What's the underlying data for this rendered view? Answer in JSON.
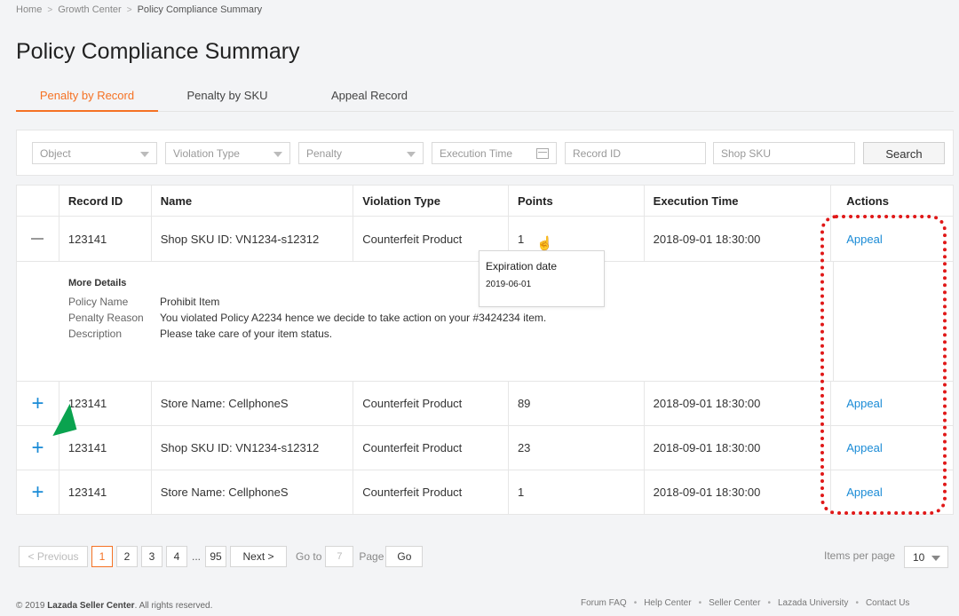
{
  "breadcrumb": [
    "Home",
    "Growth Center",
    "Policy Compliance Summary"
  ],
  "page_title": "Policy Compliance Summary",
  "tabs": [
    {
      "label": "Penalty by Record",
      "active": true
    },
    {
      "label": "Penalty by SKU",
      "active": false
    },
    {
      "label": "Appeal Record",
      "active": false
    }
  ],
  "filters": {
    "object": "Object",
    "violation_type": "Violation Type",
    "penalty": "Penalty",
    "execution_time": "Execution Time",
    "record_id": "Record ID",
    "shop_sku": "Shop SKU",
    "search_label": "Search"
  },
  "table": {
    "headers": [
      "Record ID",
      "Name",
      "Violation Type",
      "Points",
      "Execution Time",
      "Actions"
    ],
    "rows": [
      {
        "record_id": "123141",
        "name": "Shop SKU ID: VN1234-s12312",
        "violation": "Counterfeit Product",
        "points": "1",
        "time": "2018-09-01 18:30:00",
        "action": "Appeal",
        "expanded": true
      },
      {
        "record_id": "123141",
        "name": "Store Name: CellphoneS",
        "violation": "Counterfeit Product",
        "points": "89",
        "time": "2018-09-01 18:30:00",
        "action": "Appeal",
        "expanded": false
      },
      {
        "record_id": "123141",
        "name": "Shop SKU ID: VN1234-s12312",
        "violation": "Counterfeit Product",
        "points": "23",
        "time": "2018-09-01 18:30:00",
        "action": "Appeal",
        "expanded": false
      },
      {
        "record_id": "123141",
        "name": "Store Name: CellphoneS",
        "violation": "Counterfeit Product",
        "points": "1",
        "time": "2018-09-01 18:30:00",
        "action": "Appeal",
        "expanded": false
      }
    ]
  },
  "details": {
    "title": "More Details",
    "policy_name_label": "Policy Name",
    "policy_name": "Prohibit Item",
    "penalty_reason_label": "Penalty Reason",
    "penalty_reason": "You violated Policy A2234 hence we decide to take action on your #3424234 item.",
    "description_label": "Description",
    "description": "Please take care of your item status."
  },
  "tooltip": {
    "title": "Expiration date",
    "value": "2019-06-01"
  },
  "pagination": {
    "previous": "Previous",
    "pages": [
      "1",
      "2",
      "3",
      "4"
    ],
    "ellipsis": "...",
    "last_page": "95",
    "current_page": "1",
    "next": "Next",
    "goto_label": "Go to",
    "goto_value": "7",
    "page_label": "Page",
    "go_label": "Go",
    "items_per_page_label": "Items per page",
    "items_per_page": "10"
  },
  "footer": {
    "copyright_prefix": "© 2019",
    "copyright_brand": "Lazada Seller Center",
    "copyright_suffix": ". All rights reserved.",
    "links": [
      "Forum FAQ",
      "Help Center",
      "Seller Center",
      "Lazada University",
      "Contact Us"
    ],
    "separator": "•"
  },
  "colors": {
    "accent": "#f57224",
    "link": "#1a8bd6",
    "annotation_red": "#e01818",
    "annotation_green": "#0aa34f"
  }
}
